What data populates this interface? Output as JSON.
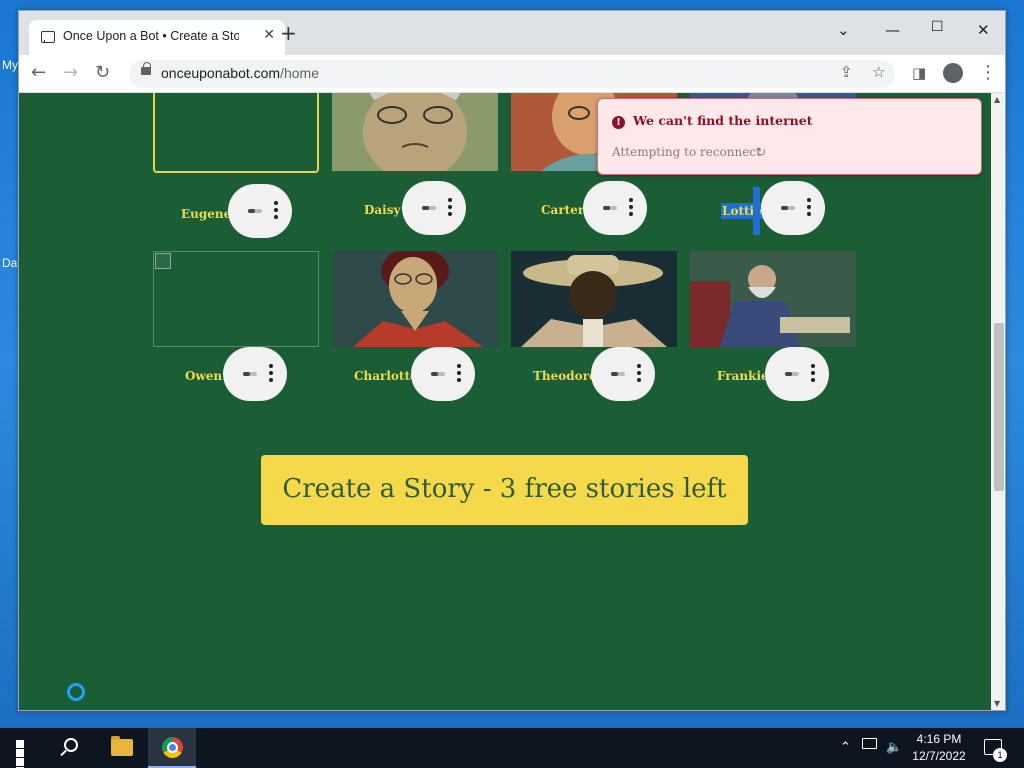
{
  "desktop": {
    "icon_labels": [
      "My",
      "Da"
    ]
  },
  "browser": {
    "tab_title": "Once Upon a Bot • Create a Story",
    "tab_close": "✕",
    "new_tab": "+",
    "url_host": "onceuponabot.com",
    "url_path": "/home"
  },
  "characters": [
    {
      "name": "Eugene",
      "image": "broken",
      "selected": true
    },
    {
      "name": "Daisy",
      "image": "portrait"
    },
    {
      "name": "Carter",
      "image": "portrait"
    },
    {
      "name": "Lottie",
      "image": "portrait",
      "highlighted": true
    },
    {
      "name": "Owen",
      "image": "broken"
    },
    {
      "name": "Charlotte",
      "image": "portrait"
    },
    {
      "name": "Theodore",
      "image": "portrait"
    },
    {
      "name": "Frankie",
      "image": "portrait"
    }
  ],
  "cta": {
    "label": "Create a Story - 3 free stories left"
  },
  "toast": {
    "title": "We can't find the internet",
    "subtitle": "Attempting to reconnect"
  },
  "taskbar": {
    "time": "4:16 PM",
    "date": "12/7/2022",
    "notifications": "1"
  },
  "colors": {
    "page_bg": "#1b5e35",
    "name_text": "#f2d94e",
    "cta_bg": "#f5d94a",
    "toast_bg": "#fde9ea",
    "toast_accent": "#8c1029"
  }
}
